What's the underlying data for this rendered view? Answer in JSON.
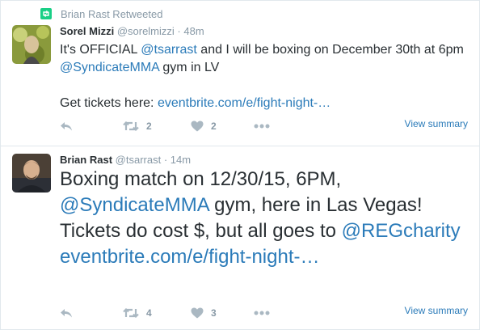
{
  "retweet_context": {
    "text": "Brian Rast Retweeted",
    "icon": "retweet-badge-icon",
    "accent": "#19cf86"
  },
  "tweets": [
    {
      "author_name": "Sorel Mizzi",
      "author_handle": "@sorelmizzi",
      "separator": "·",
      "time": "48m",
      "text_a": "It's OFFICIAL ",
      "mention_a": "@tsarrast",
      "text_b": " and I will be boxing on December 30th at 6pm",
      "mention_b": "@SyndicateMMA",
      "text_c": " gym in LV",
      "text_d": "Get tickets here: ",
      "link": "eventbrite.com/e/fight-night-…",
      "retweets": "2",
      "likes": "2",
      "view_summary": "View summary"
    },
    {
      "author_name": "Brian Rast",
      "author_handle": "@tsarrast",
      "separator": "·",
      "time": "14m",
      "text_a": "Boxing match on 12/30/15, 6PM,",
      "mention_a": "@SyndicateMMA",
      "text_b": " gym, here in Las Vegas! Tickets do cost $, but all goes to ",
      "mention_b": "@REGcharity",
      "text_c": " ",
      "link": "eventbrite.com/e/fight-night-…",
      "retweets": "4",
      "likes": "3",
      "view_summary": "View summary"
    }
  ],
  "colors": {
    "link": "#2b7bb9",
    "muted": "#8899a6",
    "icon": "#aab8c2",
    "text": "#292f33",
    "border": "#e1e8ed"
  }
}
